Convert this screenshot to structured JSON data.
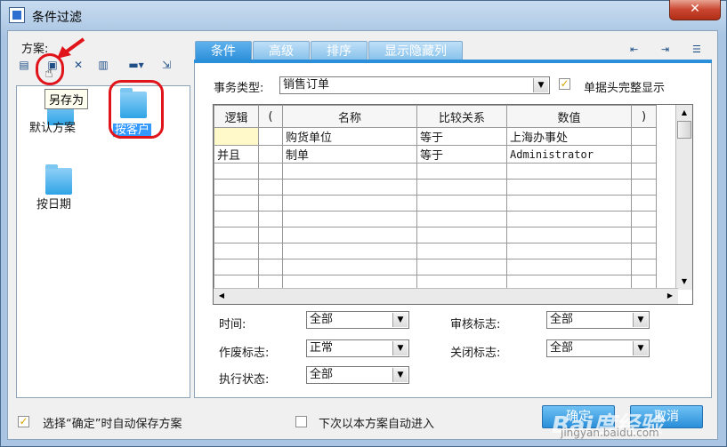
{
  "window": {
    "title": "条件过滤",
    "close_glyph": "✕"
  },
  "scheme": {
    "label": "方案:",
    "toolbar": [
      {
        "name": "save-icon",
        "glyph": "▤"
      },
      {
        "name": "save-as-icon",
        "glyph": "▣"
      },
      {
        "name": "delete-icon",
        "glyph": "✕"
      },
      {
        "name": "clear-icon",
        "glyph": "▥"
      },
      {
        "name": "more-icon",
        "glyph": "▬▾"
      },
      {
        "name": "import-icon",
        "glyph": "⇲"
      }
    ],
    "tooltip": "另存为",
    "items": [
      "默认方案",
      "按客户",
      "按日期"
    ]
  },
  "tabs": [
    "条件",
    "高级",
    "排序",
    "显示隐藏列"
  ],
  "right_tools": [
    "⇤",
    "⇥",
    "☰"
  ],
  "form": {
    "business_type_label": "事务类型:",
    "business_type_value": "销售订单",
    "full_header_label": "单据头完整显示",
    "full_header_checked": true
  },
  "grid": {
    "columns": [
      "逻辑",
      "(",
      "名称",
      "比较关系",
      "数值",
      ")"
    ],
    "rows": [
      [
        "",
        "",
        "购货单位",
        "等于",
        "上海办事处",
        ""
      ],
      [
        "并且",
        "",
        "制单",
        "等于",
        "Administrator",
        ""
      ]
    ],
    "empty_rows": 8
  },
  "filters": {
    "time_label": "时间:",
    "time_value": "全部",
    "audit_label": "审核标志:",
    "audit_value": "全部",
    "void_label": "作废标志:",
    "void_value": "正常",
    "close_label": "关闭标志:",
    "close_value": "全部",
    "exec_label": "执行状态:",
    "exec_value": "全部"
  },
  "footer": {
    "auto_save_label": "选择“确定”时自动保存方案",
    "auto_save_checked": true,
    "auto_enter_label": "下次以本方案自动进入",
    "auto_enter_checked": false,
    "ok_label": "确定",
    "cancel_label": "取消"
  },
  "watermark": {
    "main": "Bai度经验",
    "sub": "jingyan.baidu.com"
  },
  "colors": {
    "accent": "#2c8fda",
    "annotation": "#e0141a",
    "selection": "#3399ff"
  }
}
